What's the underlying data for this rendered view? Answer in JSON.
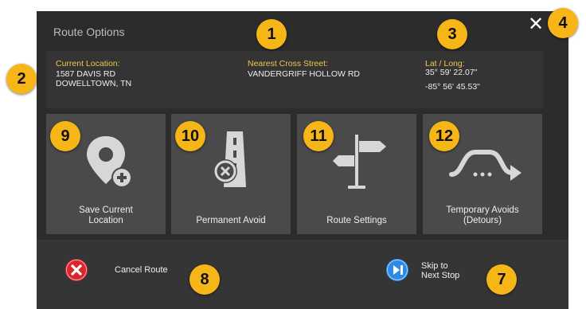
{
  "dialog": {
    "title": "Route Options",
    "close_glyph": "✕"
  },
  "info": {
    "current_location": {
      "label": "Current Location:",
      "value": "1587 DAVIS RD\nDOWELLTOWN, TN"
    },
    "cross_street": {
      "label": "Nearest Cross Street:",
      "value": "VANDERGRIFF HOLLOW RD"
    },
    "lat_long": {
      "label": "Lat / Long:",
      "value": "35° 59' 22.07\"\n\n-85° 56' 45.53\""
    }
  },
  "tiles": [
    {
      "label": "Save Current\nLocation",
      "icon": "location-pin-plus-icon"
    },
    {
      "label": "Permanent Avoid",
      "icon": "road-avoid-icon"
    },
    {
      "label": "Route Settings",
      "icon": "signpost-icon"
    },
    {
      "label": "Temporary Avoids\n(Detours)",
      "icon": "detour-arrow-icon"
    }
  ],
  "actions": {
    "cancel": {
      "label": "Cancel Route",
      "icon": "cancel-x-icon",
      "color": "#d9262f"
    },
    "skip": {
      "label": "Skip to\nNext Stop",
      "icon": "skip-next-icon",
      "color": "#2b8be6"
    }
  },
  "callouts": [
    "1",
    "2",
    "3",
    "4",
    "7",
    "8",
    "9",
    "10",
    "11",
    "12"
  ],
  "colors": {
    "accent_label": "#f0c64b",
    "callout_badge": "#f7b618",
    "panel_bg": "#2c2c2c",
    "tile_bg": "#4a4a4a"
  }
}
